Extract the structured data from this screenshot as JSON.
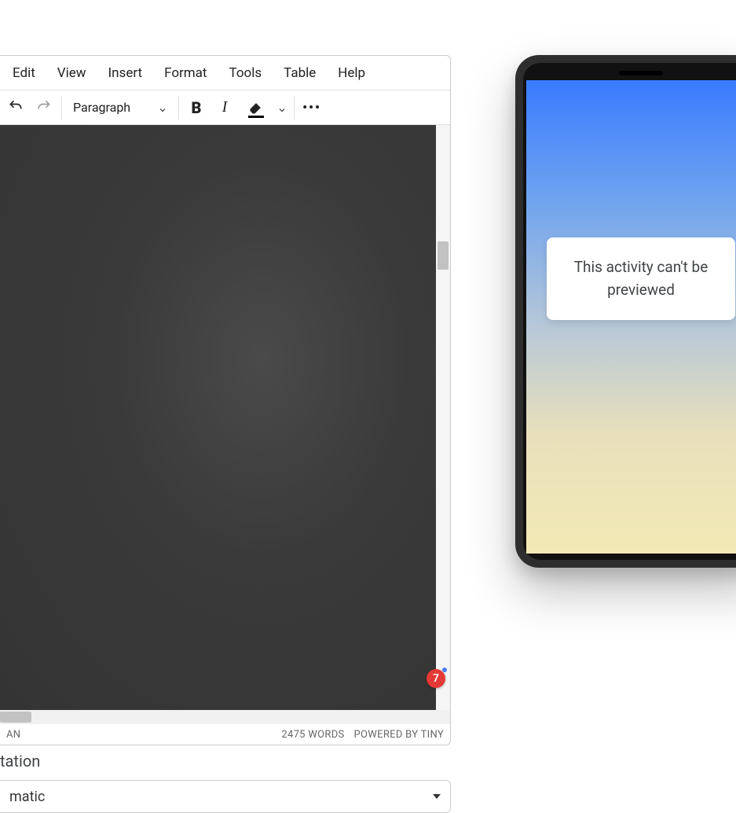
{
  "menubar": {
    "items": [
      "Edit",
      "View",
      "Insert",
      "Format",
      "Tools",
      "Table",
      "Help"
    ]
  },
  "toolbar": {
    "format_select": "Paragraph"
  },
  "status": {
    "left": "AN",
    "words": "2475 WORDS",
    "powered": "POWERED BY TINY"
  },
  "notification_count": "7",
  "bottom": {
    "label_fragment": "tation",
    "select_value_fragment": "matic"
  },
  "phone": {
    "message": "This activity can't be previewed"
  }
}
